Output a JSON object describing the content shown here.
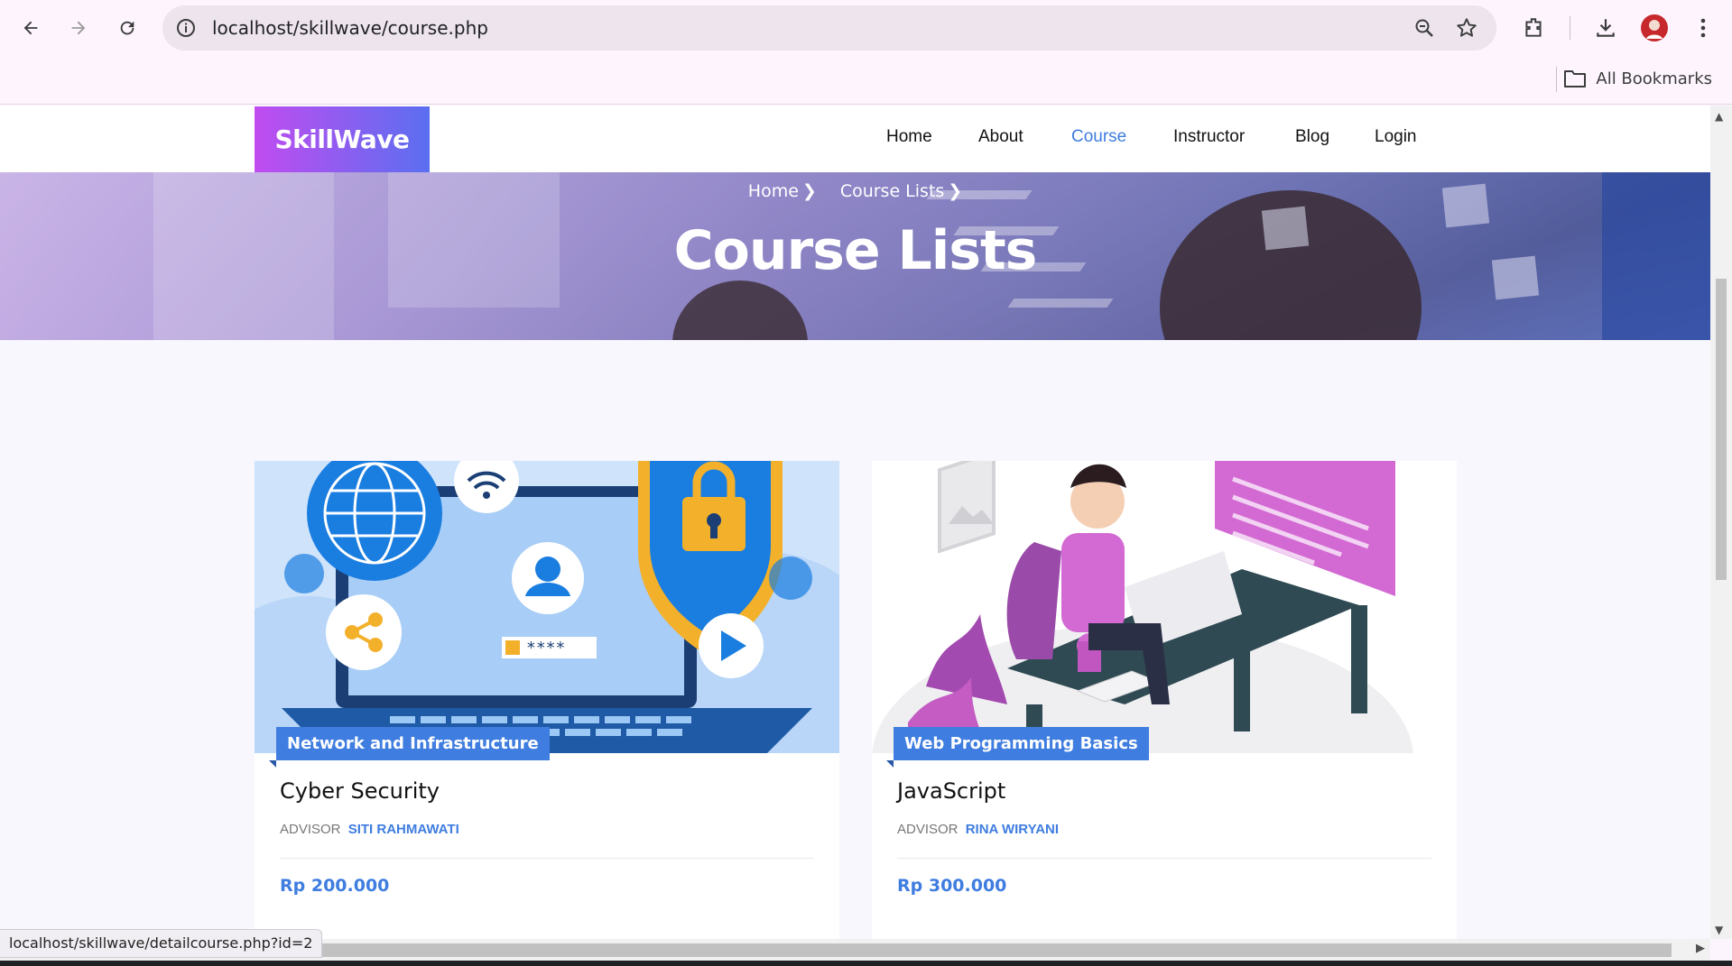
{
  "browser": {
    "url": "localhost/skillwave/course.php",
    "all_bookmarks": "All Bookmarks",
    "status_url": "localhost/skillwave/detailcourse.php?id=2"
  },
  "site": {
    "logo": "SkillWave",
    "nav": [
      "Home",
      "About",
      "Course",
      "Instructor",
      "Blog",
      "Login"
    ],
    "active_nav": "Course",
    "accent_color": "#3f7de0"
  },
  "hero": {
    "breadcrumb": [
      "Home",
      "Course Lists"
    ],
    "title": "Course Lists"
  },
  "courses": [
    {
      "category": "Network and Infrastructure",
      "title": "Cyber Security",
      "advisor_label": "ADVISOR",
      "advisor_name": "SITI RAHMAWATI",
      "price": "Rp 200.000",
      "password_mask": "****"
    },
    {
      "category": "Web Programming Basics",
      "title": "JavaScript",
      "advisor_label": "ADVISOR",
      "advisor_name": "RINA WIRYANI",
      "price": "Rp 300.000"
    }
  ]
}
